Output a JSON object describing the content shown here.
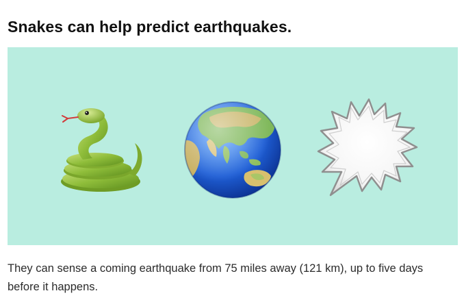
{
  "article": {
    "headline": "Snakes can help predict earthquakes.",
    "caption": "They can sense a coming earthquake from 75 miles away (121 km), up to five days before it happens."
  },
  "hero": {
    "background_color": "#b9ede0",
    "icons": [
      "snake-emoji",
      "earth-globe-emoji",
      "anger-bubble-emoji"
    ]
  }
}
